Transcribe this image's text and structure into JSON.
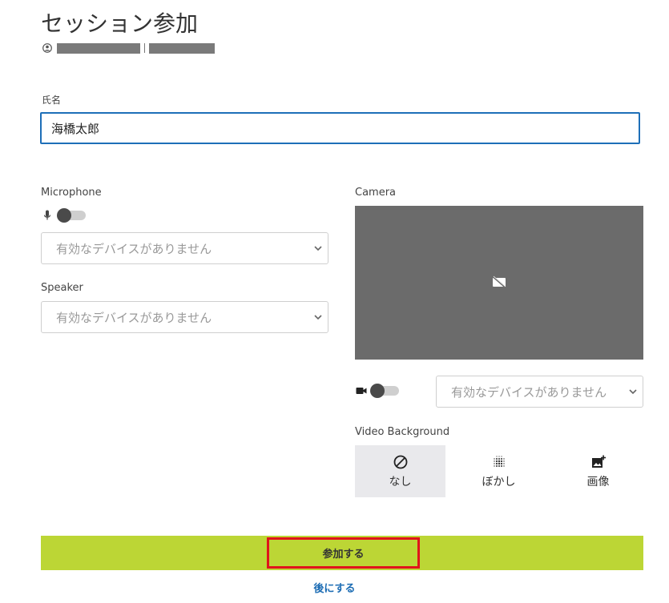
{
  "page": {
    "title": "セッション参加"
  },
  "name_field": {
    "label": "氏名",
    "value": "海橋太郎"
  },
  "microphone": {
    "label": "Microphone",
    "enabled": false,
    "device_select": "有効なデバイスがありません"
  },
  "speaker": {
    "label": "Speaker",
    "device_select": "有効なデバイスがありません"
  },
  "camera": {
    "label": "Camera",
    "enabled": false,
    "device_select": "有効なデバイスがありません"
  },
  "video_background": {
    "label": "Video Background",
    "options": [
      {
        "label": "なし",
        "icon": "no-background-icon",
        "selected": true
      },
      {
        "label": "ぼかし",
        "icon": "blur-icon",
        "selected": false
      },
      {
        "label": "画像",
        "icon": "add-image-icon",
        "selected": false
      }
    ]
  },
  "actions": {
    "join": "参加する",
    "later": "後にする"
  },
  "colors": {
    "join_bar": "#bcd635",
    "focus_border": "#1e6fb8",
    "highlight_border": "#e0141b",
    "link": "#1a6bb3"
  }
}
